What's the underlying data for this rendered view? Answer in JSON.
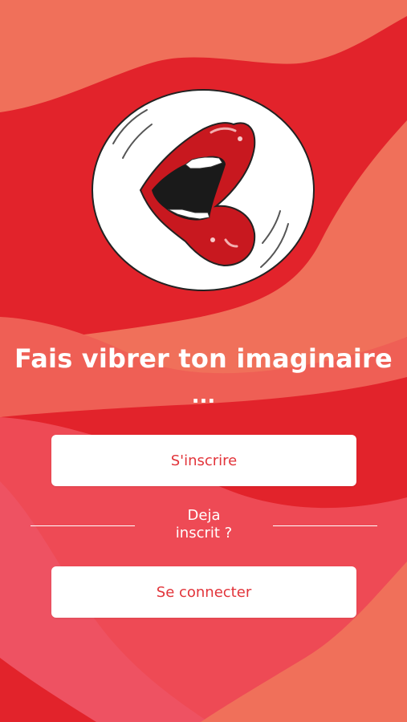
{
  "app": {
    "headline": "Fais vibrer ton imaginaire",
    "ellipsis": "...",
    "signup_label": "S'inscrire",
    "divider_line1": "Deja",
    "divider_line2": "inscrit ?",
    "login_label": "Se connecter"
  },
  "icons": {
    "logo": "lips-logo-icon"
  },
  "colors": {
    "background_red": "#e2232b",
    "wave_coral": "#f0705a",
    "wave_pink": "#ee5262",
    "button_text": "#e2343a",
    "button_bg": "#ffffff",
    "text_white": "#ffffff"
  }
}
